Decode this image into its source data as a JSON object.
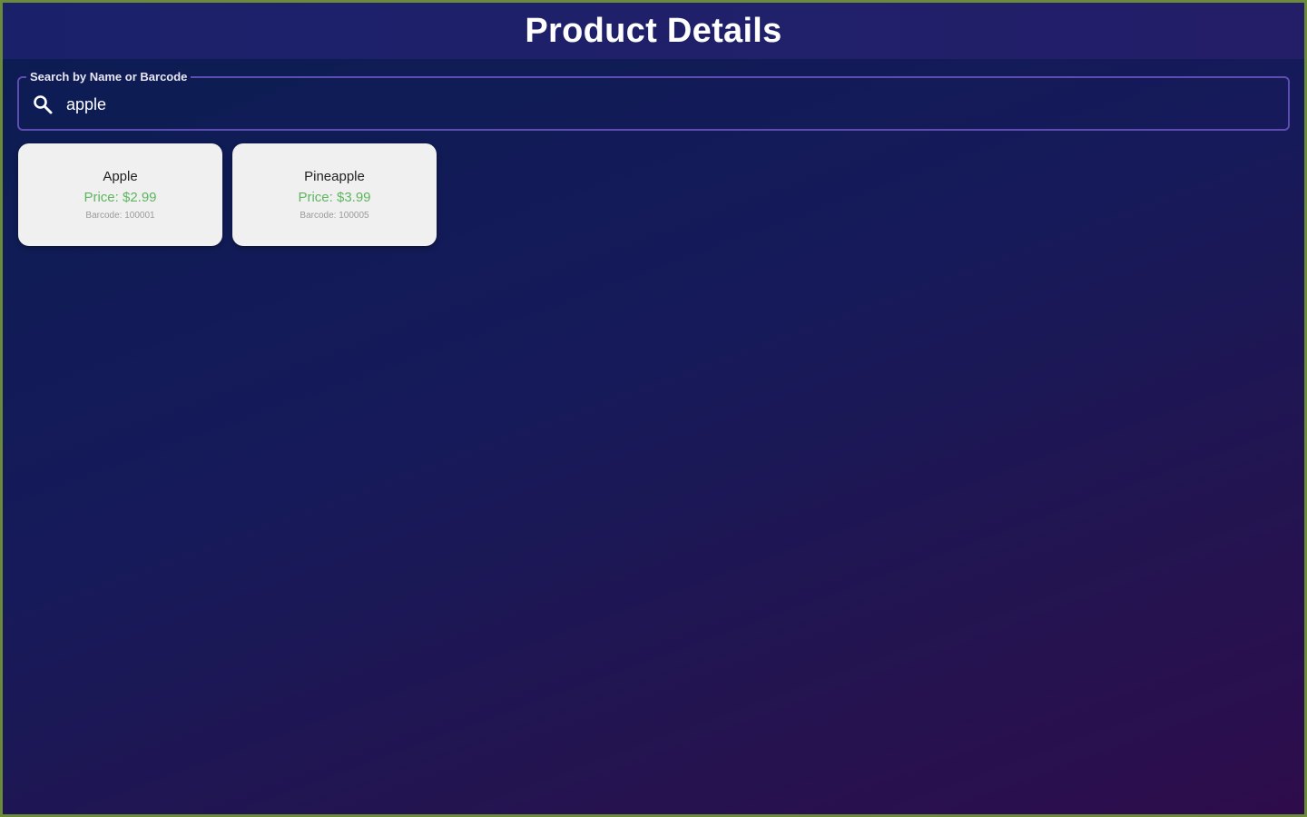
{
  "header": {
    "title": "Product Details"
  },
  "search": {
    "label": "Search by Name or Barcode",
    "value": "apple",
    "icon": "search-icon"
  },
  "results": [
    {
      "name": "Apple",
      "price": "Price: $2.99",
      "barcode": "Barcode: 100001"
    },
    {
      "name": "Pineapple",
      "price": "Price: $3.99",
      "barcode": "Barcode: 100005"
    }
  ],
  "colors": {
    "header_bg": "#1f1f69",
    "border_accent": "#5e4db0",
    "price_green": "#5fb55f",
    "card_bg": "#f0f0f0",
    "frame_border": "#6b8a3a"
  }
}
